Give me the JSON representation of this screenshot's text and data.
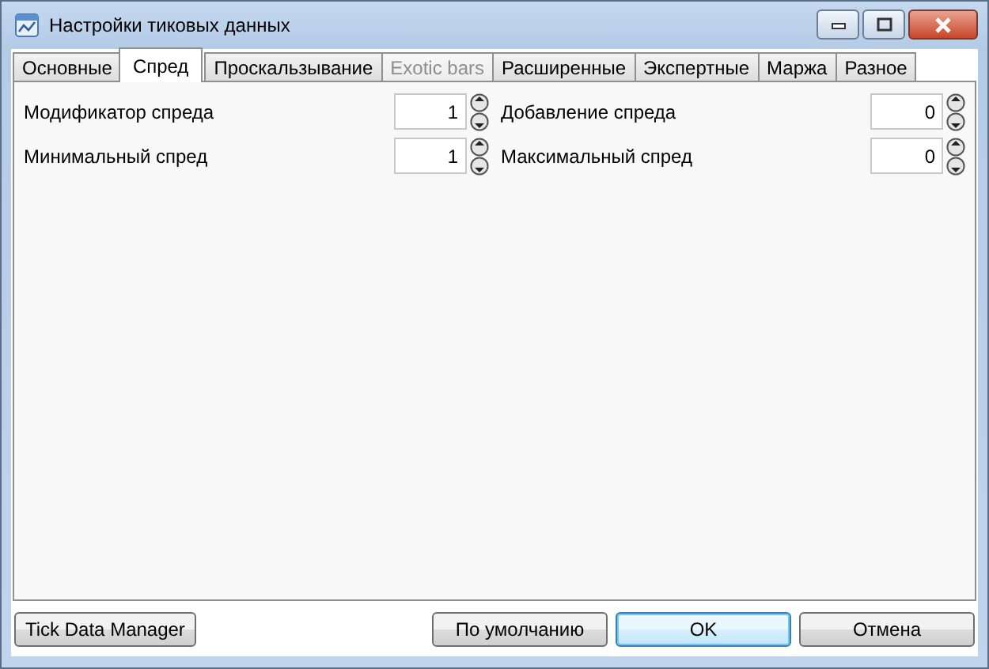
{
  "window": {
    "title": "Настройки тиковых данных"
  },
  "tabs": [
    {
      "label": "Основные",
      "selected": false,
      "disabled": false
    },
    {
      "label": "Спред",
      "selected": true,
      "disabled": false
    },
    {
      "label": "Проскальзывание",
      "selected": false,
      "disabled": false
    },
    {
      "label": "Exotic bars",
      "selected": false,
      "disabled": true
    },
    {
      "label": "Расширенные",
      "selected": false,
      "disabled": false
    },
    {
      "label": "Экспертные",
      "selected": false,
      "disabled": false
    },
    {
      "label": "Маржа",
      "selected": false,
      "disabled": false
    },
    {
      "label": "Разное",
      "selected": false,
      "disabled": false
    }
  ],
  "fields": [
    {
      "label": "Модификатор спреда",
      "value": "1"
    },
    {
      "label": "Добавление спреда",
      "value": "0"
    },
    {
      "label": "Минимальный спред",
      "value": "1"
    },
    {
      "label": "Максимальный спред",
      "value": "0"
    }
  ],
  "left_buttons": [
    {
      "label": "Tick Data Manager",
      "default": false
    }
  ],
  "right_buttons": [
    {
      "label": "По умолчанию",
      "default": false
    },
    {
      "label": "OK",
      "default": true
    },
    {
      "label": "Отмена",
      "default": false
    }
  ]
}
